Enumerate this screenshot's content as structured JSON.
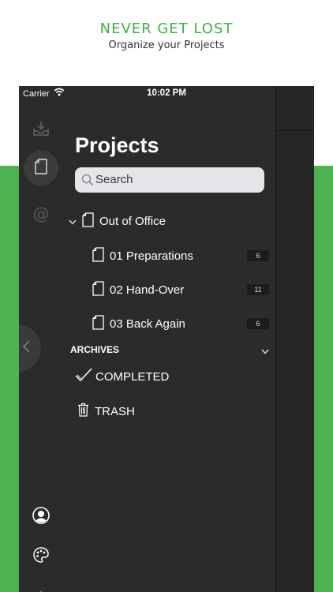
{
  "promo": {
    "headline": "NEVER GET LOST",
    "subline": "Organize your Projects"
  },
  "status_bar": {
    "carrier": "Carrier",
    "time": "10:02 PM"
  },
  "sidebar": {
    "icons": [
      "inbox-icon",
      "project-icon",
      "at-icon"
    ],
    "active": "project-icon",
    "bottom_icons": [
      "account-icon",
      "palette-icon",
      "gear-icon"
    ]
  },
  "main": {
    "title": "Projects",
    "search_placeholder": "Search",
    "folder": {
      "label": "Out of Office",
      "expanded": true
    },
    "projects": [
      {
        "label": "01 Preparations",
        "count": "6"
      },
      {
        "label": "02 Hand-Over",
        "count": "11"
      },
      {
        "label": "03 Back Again",
        "count": "6"
      }
    ],
    "archives_label": "ARCHIVES",
    "archive_items": [
      {
        "label": "COMPLETED",
        "icon": "checkmark-icon"
      },
      {
        "label": "TRASH",
        "icon": "trash-icon"
      }
    ]
  },
  "colors": {
    "brand_green": "#4db34f",
    "headline_green": "#3fae44",
    "device_bg": "#2b2b2b"
  }
}
